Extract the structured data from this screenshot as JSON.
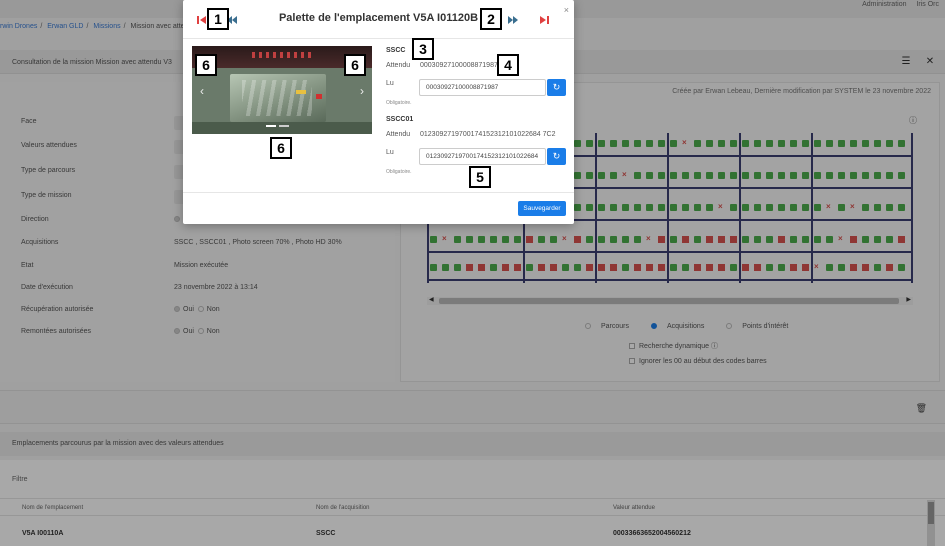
{
  "topbar": {
    "admin": "Administration",
    "user": "Iris Orc"
  },
  "breadcrumb": {
    "items": [
      "rwin Drones",
      "Erwan GLD",
      "Missions",
      "Mission avec attend"
    ]
  },
  "panel": {
    "title": "Consultation de la mission Mission avec attendu V3"
  },
  "fields": [
    {
      "label": "Face",
      "value": ""
    },
    {
      "label": "Valeurs attendues",
      "value": ""
    },
    {
      "label": "Type de parcours",
      "value": ""
    },
    {
      "label": "Type de mission",
      "value": ""
    },
    {
      "label": "Direction",
      "value": ""
    },
    {
      "label": "Acquisitions",
      "value": "SSCC , SSCC01 , Photo screen 70% , Photo HD 30%"
    },
    {
      "label": "Etat",
      "value": "Mission exécutée"
    },
    {
      "label": "Date d'exécution",
      "value": "23 novembre 2022 à 13:14"
    },
    {
      "label": "Récupération autorisée",
      "yes": "Oui",
      "no": "Non"
    },
    {
      "label": "Remontées autorisées",
      "yes": "Oui",
      "no": "Non"
    }
  ],
  "right": {
    "created": "Créée par Erwan Lebeau, Dernière modification par SYSTEM le 23 novembre 2022",
    "options": {
      "parcours": "Parcours",
      "acquisitions": "Acquisitions",
      "points": "Points d'intérêt"
    },
    "recherche": "Recherche dynamique",
    "ignorer": "Ignorer les 00 au début des codes barres"
  },
  "bottom": {
    "title": "Emplacements parcourus par la mission avec des valeurs attendues",
    "filtre": "Filtre",
    "headers": [
      "Nom de l'emplacement",
      "Nom de l'acquisition",
      "Valeur attendue"
    ],
    "row": [
      "V5A I00110A",
      "SSCC",
      "00033663652004560212"
    ]
  },
  "modal": {
    "title": "Palette de l'emplacement V5A I01120B",
    "close": "×",
    "sscc": {
      "title": "SSCC",
      "attendu_label": "Attendu",
      "attendu": "00030927100008871987",
      "lu_label": "Lu",
      "lu": "00030927100008871987",
      "oblig": "Obligatoire."
    },
    "sscc01": {
      "title": "SSCC01",
      "attendu_label": "Attendu",
      "attendu": "0123092719700174152312101022684 7C2",
      "lu_label": "Lu",
      "lu": "0123092719700174152312101022684",
      "oblig": "Obligatoire."
    },
    "save": "Sauvegarder"
  },
  "badges": {
    "b1": "1",
    "b2": "2",
    "b3": "3",
    "b4": "4",
    "b5": "5",
    "b6": "6"
  },
  "colors": {
    "accent": "#1a7de8",
    "ok": "#4cae4c",
    "error": "#d9534f",
    "rack": "#3c3f73"
  }
}
